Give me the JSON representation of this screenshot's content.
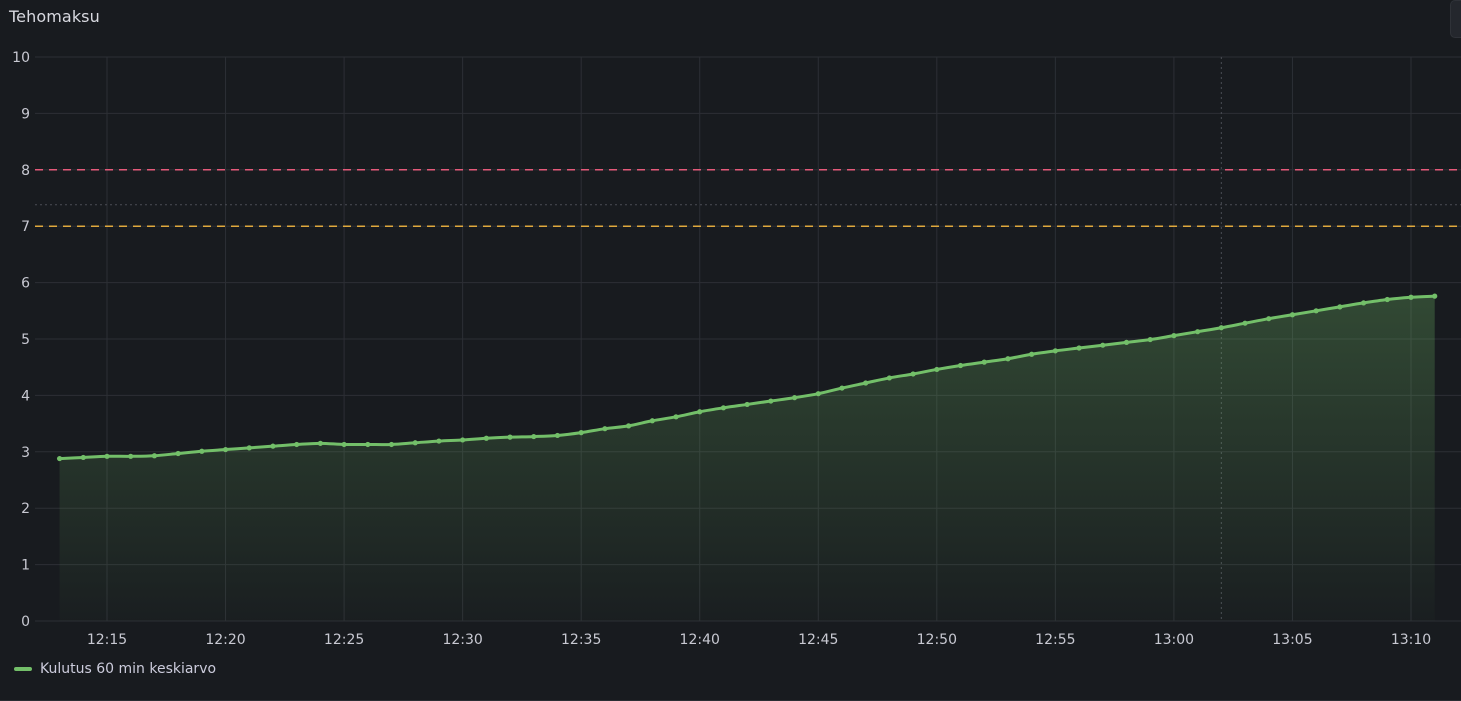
{
  "panel": {
    "title": "Tehomaksu"
  },
  "colors": {
    "background": "#181b1f",
    "grid": "#2c2f35",
    "series": "#73bf69",
    "threshold_red": "#e45a7a",
    "threshold_orange": "#e0a93d",
    "crosshair": "#4a4d55"
  },
  "chart_data": {
    "type": "area",
    "ylim": [
      0,
      10
    ],
    "yticks": [
      0,
      1,
      2,
      3,
      4,
      5,
      6,
      7,
      8,
      9,
      10
    ],
    "xlim_minutes": [
      "12:13",
      "13:11"
    ],
    "xticks": [
      "12:15",
      "12:20",
      "12:25",
      "12:30",
      "12:35",
      "12:40",
      "12:45",
      "12:50",
      "12:55",
      "13:00",
      "13:05",
      "13:10"
    ],
    "grid": true,
    "legend_placement": "bottom-left",
    "thresholds": [
      {
        "value": 8,
        "color": "#e45a7a",
        "style": "dashed"
      },
      {
        "value": 7,
        "color": "#e0a93d",
        "style": "dashed"
      }
    ],
    "crosshair": {
      "x": "13:02",
      "y": 7.38
    },
    "series": [
      {
        "name": "Kulutus 60 min keskiarvo",
        "color": "#73bf69",
        "x": [
          "12:13",
          "12:14",
          "12:15",
          "12:16",
          "12:17",
          "12:18",
          "12:19",
          "12:20",
          "12:21",
          "12:22",
          "12:23",
          "12:24",
          "12:25",
          "12:26",
          "12:27",
          "12:28",
          "12:29",
          "12:30",
          "12:31",
          "12:32",
          "12:33",
          "12:34",
          "12:35",
          "12:36",
          "12:37",
          "12:38",
          "12:39",
          "12:40",
          "12:41",
          "12:42",
          "12:43",
          "12:44",
          "12:45",
          "12:46",
          "12:47",
          "12:48",
          "12:49",
          "12:50",
          "12:51",
          "12:52",
          "12:53",
          "12:54",
          "12:55",
          "12:56",
          "12:57",
          "12:58",
          "12:59",
          "13:00",
          "13:01",
          "13:02",
          "13:03",
          "13:04",
          "13:05",
          "13:06",
          "13:07",
          "13:08",
          "13:09",
          "13:10",
          "13:11"
        ],
        "values": [
          2.88,
          2.9,
          2.92,
          2.92,
          2.93,
          2.97,
          3.01,
          3.04,
          3.07,
          3.1,
          3.13,
          3.15,
          3.13,
          3.13,
          3.13,
          3.16,
          3.19,
          3.21,
          3.24,
          3.26,
          3.27,
          3.29,
          3.34,
          3.41,
          3.46,
          3.55,
          3.62,
          3.71,
          3.78,
          3.84,
          3.9,
          3.96,
          4.03,
          4.13,
          4.22,
          4.31,
          4.38,
          4.46,
          4.53,
          4.59,
          4.65,
          4.73,
          4.79,
          4.84,
          4.89,
          4.94,
          4.99,
          5.06,
          5.13,
          5.2,
          5.28,
          5.36,
          5.43,
          5.5,
          5.57,
          5.64,
          5.7,
          5.74,
          5.76
        ]
      }
    ]
  }
}
